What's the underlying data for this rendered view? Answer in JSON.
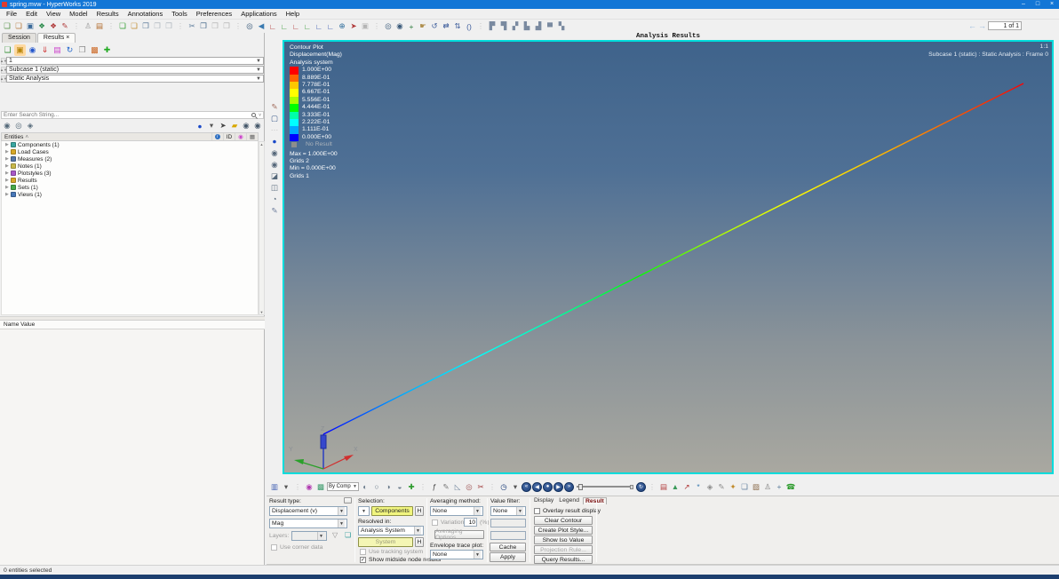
{
  "titlebar": {
    "title": "spring.mvw - HyperWorks 2019",
    "minimize": "–",
    "maximize": "□",
    "close": "×"
  },
  "menu": {
    "items": [
      {
        "n": "menu-file",
        "label": "File"
      },
      {
        "n": "menu-edit",
        "label": "Edit"
      },
      {
        "n": "menu-view",
        "label": "View"
      },
      {
        "n": "menu-model",
        "label": "Model"
      },
      {
        "n": "menu-results",
        "label": "Results"
      },
      {
        "n": "menu-annotations",
        "label": "Annotations"
      },
      {
        "n": "menu-tools",
        "label": "Tools"
      },
      {
        "n": "menu-preferences",
        "label": "Preferences"
      },
      {
        "n": "menu-applications",
        "label": "Applications"
      },
      {
        "n": "menu-help",
        "label": "Help"
      }
    ]
  },
  "toolbar_top": {
    "icons": [
      {
        "n": "open-session-icon",
        "g": "❏",
        "c": "#4a8a3a"
      },
      {
        "n": "save-session-icon",
        "g": "❏",
        "c": "#b07030"
      },
      {
        "n": "save-all-icon",
        "g": "▣",
        "c": "#3a6a9a"
      },
      {
        "n": "organize-icon",
        "g": "❖",
        "c": "#2a8a4a"
      },
      {
        "n": "import-icon",
        "g": "❖",
        "c": "#b03a3a"
      },
      {
        "n": "export-curve-icon",
        "g": "✎",
        "c": "#b03a3a"
      },
      {
        "n": "separator",
        "g": "⋮",
        "c": "#c4c4c4"
      },
      {
        "n": "user-profile-icon",
        "g": "♙",
        "c": "#909090"
      },
      {
        "n": "pages-icon",
        "g": "▤",
        "c": "#b06a2a"
      },
      {
        "n": "separator",
        "g": "⋮",
        "c": "#c4c4c4"
      },
      {
        "n": "add-page-icon",
        "g": "❏",
        "c": "#2a9a2a"
      },
      {
        "n": "delete-page-icon",
        "g": "❏",
        "c": "#c08a2a"
      },
      {
        "n": "new-window-icon",
        "g": "❐",
        "c": "#5a7a9a"
      },
      {
        "n": "expand-window-icon",
        "g": "❐",
        "c": "#aeb6be"
      },
      {
        "n": "swap-pages-icon",
        "g": "❒",
        "c": "#aeb6be"
      },
      {
        "n": "separator",
        "g": "⋮",
        "c": "#c4c4c4"
      },
      {
        "n": "cut-icon",
        "g": "✂",
        "c": "#5a7a9a"
      },
      {
        "n": "copy-icon",
        "g": "❐",
        "c": "#46688a"
      },
      {
        "n": "paste-icon",
        "g": "❒",
        "c": "#b4b4b4"
      },
      {
        "n": "paste-special-icon",
        "g": "❒",
        "c": "#b4b4b4"
      },
      {
        "n": "separator",
        "g": "⋮",
        "c": "#c4c4c4"
      },
      {
        "n": "screen-grab-icon",
        "g": "◎",
        "c": "#3a5a7a"
      },
      {
        "n": "previous-view-icon",
        "g": "◀",
        "c": "#3a7ab0"
      },
      {
        "n": "view-front-icon",
        "g": "∟",
        "c": "#b03a3a"
      },
      {
        "n": "view-back-icon",
        "g": "∟",
        "c": "#3a9a3a"
      },
      {
        "n": "view-left-icon",
        "g": "∟",
        "c": "#b03a3a"
      },
      {
        "n": "view-right-icon",
        "g": "∟",
        "c": "#3a9a3a"
      },
      {
        "n": "view-top-icon",
        "g": "∟",
        "c": "#3a5ab0"
      },
      {
        "n": "view-bottom-icon",
        "g": "∟",
        "c": "#3a5ab0"
      },
      {
        "n": "view-iso-icon",
        "g": "⊕",
        "c": "#2a6a9a"
      },
      {
        "n": "pointer-mode-icon",
        "g": "➤",
        "c": "#b03a3a"
      },
      {
        "n": "snapshot-icon",
        "g": "▣",
        "c": "#b4b4b4"
      },
      {
        "n": "separator",
        "g": "⋮",
        "c": "#c4c4c4"
      },
      {
        "n": "zoom-window-icon",
        "g": "◎",
        "c": "#3a5a7a"
      },
      {
        "n": "zoom-dynamic-icon",
        "g": "◉",
        "c": "#3a5a7a"
      },
      {
        "n": "fit-view-icon",
        "g": "+",
        "c": "#2a7a3a"
      },
      {
        "n": "pan-icon",
        "g": "☛",
        "c": "#b09050"
      },
      {
        "n": "rotate-icon",
        "g": "↺",
        "c": "#3a5a9a"
      },
      {
        "n": "arrows-horizontal-icon",
        "g": "⇄",
        "c": "#3a5a9a"
      },
      {
        "n": "arrows-vertical-icon",
        "g": "⇅",
        "c": "#3a5a9a"
      },
      {
        "n": "center-view-icon",
        "g": "()",
        "c": "#3a5a9a"
      },
      {
        "n": "separator",
        "g": "⋮",
        "c": "#c4c4c4"
      },
      {
        "n": "tile-horizontal-icon",
        "g": "▛",
        "c": "#7a8aa0"
      },
      {
        "n": "tile-vertical-icon",
        "g": "▜",
        "c": "#7a8aa0"
      },
      {
        "n": "tile-grid-icon",
        "g": "▞",
        "c": "#7a8aa0"
      },
      {
        "n": "tile-wide-icon",
        "g": "▙",
        "c": "#7a8aa0"
      },
      {
        "n": "tile-tall-icon",
        "g": "▟",
        "c": "#7a8aa0"
      },
      {
        "n": "tile-single-icon",
        "g": "▀",
        "c": "#7a8aa0"
      },
      {
        "n": "tile-custom-icon",
        "g": "▚",
        "c": "#7a8aa0"
      }
    ],
    "page_nav": {
      "prev": "←",
      "next": "→",
      "value": "1 of 1"
    }
  },
  "browser": {
    "tabs": {
      "session": "Session",
      "results": "Results",
      "close": "×"
    },
    "toolbar": [
      {
        "n": "session-new-icon",
        "g": "❏",
        "c": "#2a8a2a"
      },
      {
        "n": "open-model-icon",
        "g": "▣",
        "c": "#b8860b",
        "bg": "#ffd9a0"
      },
      {
        "n": "load-model-icon",
        "g": "◉",
        "c": "#2255cc"
      },
      {
        "n": "load-results-icon",
        "g": "⇓",
        "c": "#cc2222"
      },
      {
        "n": "contour-file-icon",
        "g": "▤",
        "c": "#cc44cc"
      },
      {
        "n": "refresh-results-icon",
        "g": "↻",
        "c": "#2266cc"
      },
      {
        "n": "copy-file-icon",
        "g": "❐",
        "c": "#8a8a8a"
      },
      {
        "n": "overlay-results-icon",
        "g": "▩",
        "c": "#cc6622"
      },
      {
        "n": "append-results-icon",
        "g": "✚",
        "c": "#22aa22"
      }
    ],
    "combos": {
      "page": "1",
      "subcase": "Subcase 1 (static)",
      "analysis": "Static Analysis"
    },
    "search": {
      "placeholder": "Enter Search String..."
    },
    "vis_icons": [
      {
        "n": "show-entities-icon",
        "g": "◉",
        "c": "#566a7a"
      },
      {
        "n": "hide-entities-icon",
        "g": "◎",
        "c": "#566a7a"
      },
      {
        "n": "isolate-entities-icon",
        "g": "◈",
        "c": "#566a7a"
      }
    ],
    "view_icons": [
      {
        "n": "display-lens-icon",
        "g": "●",
        "c": "#1a49c8"
      },
      {
        "n": "lens-dropdown-icon",
        "g": "▾",
        "c": "#555555"
      },
      {
        "n": "selector-arrow-icon",
        "g": "➤",
        "c": "#444444"
      },
      {
        "n": "highlight-icon",
        "g": "▰",
        "c": "#d8a800"
      },
      {
        "n": "show-hide-eye-icon",
        "g": "◉",
        "c": "#46586a"
      },
      {
        "n": "show-one-eye-icon",
        "g": "◉",
        "c": "#46586a"
      }
    ],
    "entities": {
      "title": "Entities",
      "sort": "˄",
      "col_id": "ID"
    },
    "tree": [
      {
        "n": "tree-item-components",
        "label": "Components (1)",
        "c": "#3aa6a0"
      },
      {
        "n": "tree-item-load-cases",
        "label": "Load Cases",
        "c": "#d8a828"
      },
      {
        "n": "tree-item-measures",
        "label": "Measures (2)",
        "c": "#5577aa"
      },
      {
        "n": "tree-item-notes",
        "label": "Notes (1)",
        "c": "#c8b84a"
      },
      {
        "n": "tree-item-plotstyles",
        "label": "Plotstyles (3)",
        "c": "#a858c8"
      },
      {
        "n": "tree-item-results",
        "label": "Results",
        "c": "#d8a828"
      },
      {
        "n": "tree-item-sets",
        "label": "Sets (1)",
        "c": "#48a848"
      },
      {
        "n": "tree-item-views",
        "label": "Views (1)",
        "c": "#4878b8"
      }
    ],
    "name_value": "Name Value"
  },
  "viewport": {
    "title": "Analysis Results",
    "scale_label": "1:1",
    "frame_label": "Subcase 1 (static) : Static Analysis : Frame 0",
    "axis": {
      "x": "X",
      "y": "Y",
      "z": "Z"
    },
    "legend": {
      "lines": [
        "Contour Plot",
        "Displacement(Mag)",
        "Analysis system"
      ],
      "bands": [
        {
          "n": "legend-band-1",
          "value": "1.000E+00",
          "c": "#ff0000"
        },
        {
          "n": "legend-band-2",
          "value": "8.889E-01",
          "c": "#ff6400"
        },
        {
          "n": "legend-band-3",
          "value": "7.778E-01",
          "c": "#ffc800"
        },
        {
          "n": "legend-band-4",
          "value": "6.667E-01",
          "c": "#ffff00"
        },
        {
          "n": "legend-band-5",
          "value": "5.556E-01",
          "c": "#a8ff00"
        },
        {
          "n": "legend-band-6",
          "value": "4.444E-01",
          "c": "#00ff00"
        },
        {
          "n": "legend-band-7",
          "value": "3.333E-01",
          "c": "#00ffa8"
        },
        {
          "n": "legend-band-8",
          "value": "2.222E-01",
          "c": "#00ffff"
        },
        {
          "n": "legend-band-9",
          "value": "1.111E-01",
          "c": "#00a8ff"
        },
        {
          "n": "legend-band-10",
          "value": "0.000E+00",
          "c": "#0000ff"
        }
      ],
      "no_result": "No Result",
      "stats": [
        "Max = 1.000E+00",
        "Grids 2",
        "Min = 0.000E+00",
        "Grids 1"
      ]
    },
    "side_toolbar": [
      {
        "n": "page-edit-icon",
        "g": "✎",
        "c": "#a06a5a"
      },
      {
        "n": "screen-layout-icon",
        "g": "▢",
        "c": "#3a5a8a"
      },
      {
        "n": "separator",
        "g": "⋯",
        "c": "#c4c4c4"
      },
      {
        "n": "view-lens-icon",
        "g": "●",
        "c": "#1a49c8"
      },
      {
        "n": "eye-restore-icon",
        "g": "◉",
        "c": "#56687a"
      },
      {
        "n": "eye-previous-icon",
        "g": "◉",
        "c": "#56687a"
      },
      {
        "n": "eye-capture-icon",
        "g": "◪",
        "c": "#56687a"
      },
      {
        "n": "eye-save-icon",
        "g": "◫",
        "c": "#56687a"
      },
      {
        "n": "eye-mask-icon",
        "g": "◔",
        "c": "#56687a"
      },
      {
        "n": "brush-icon",
        "g": "✎",
        "c": "#6a7a9a"
      }
    ]
  },
  "toolbar_result": {
    "icons_left": [
      {
        "n": "contour-mode-icon",
        "g": "▥",
        "c": "#3a5ab0"
      },
      {
        "n": "contour-dropdown-icon",
        "g": "▾",
        "c": "#555555"
      },
      {
        "n": "separator",
        "g": "⋮",
        "c": "#c4c4c4"
      },
      {
        "n": "legend-colors-icon",
        "g": "◉",
        "c": "#b03ab0"
      },
      {
        "n": "result-display-icon",
        "g": "▩",
        "c": "#3a9a6a"
      }
    ],
    "by_comp": "By Comp",
    "icons_mid": [
      {
        "n": "shaded-mesh-icon",
        "g": "◐",
        "c": "#6a7a8a"
      },
      {
        "n": "wireframe-mesh-icon",
        "g": "○",
        "c": "#6a7a8a"
      },
      {
        "n": "element-color-icon",
        "g": "◑",
        "c": "#6a7a8a"
      },
      {
        "n": "feature-lines-icon",
        "g": "◒",
        "c": "#6a7a8a"
      },
      {
        "n": "mask-add-icon",
        "g": "✚",
        "c": "#2a9a2a"
      },
      {
        "n": "separator",
        "g": "⋮",
        "c": "#c4c4c4"
      },
      {
        "n": "quick-query-icon",
        "g": "ƒ",
        "c": "#444444"
      },
      {
        "n": "note-create-icon",
        "g": "✎",
        "c": "#777777"
      },
      {
        "n": "measure-create-icon",
        "g": "◺",
        "c": "#778aa0"
      },
      {
        "n": "tracking-system-icon",
        "g": "◎",
        "c": "#a05a5a"
      },
      {
        "n": "section-cut-icon",
        "g": "✂",
        "c": "#a03a3a"
      },
      {
        "n": "separator",
        "g": "⋮",
        "c": "#c4c4c4"
      },
      {
        "n": "animation-clock-icon",
        "g": "◷",
        "c": "#1c3e78"
      },
      {
        "n": "clock-dropdown-icon",
        "g": "▾",
        "c": "#555555"
      }
    ],
    "anim_buttons": [
      {
        "n": "first-frame-button",
        "g": "«"
      },
      {
        "n": "previous-frame-button",
        "g": "◀"
      },
      {
        "n": "stop-button",
        "g": "●"
      },
      {
        "n": "play-button",
        "g": "▶"
      },
      {
        "n": "last-frame-button",
        "g": "»"
      }
    ],
    "loop_button": "↻",
    "icons_right": [
      {
        "n": "separator",
        "g": "⋮",
        "c": "#c4c4c4"
      },
      {
        "n": "contour-toggle-icon",
        "g": "▤",
        "c": "#b03a3a"
      },
      {
        "n": "iso-toggle-icon",
        "g": "▲",
        "c": "#3a9a5a"
      },
      {
        "n": "vector-toggle-icon",
        "g": "↗",
        "c": "#b03a3a"
      },
      {
        "n": "tensor-toggle-icon",
        "g": "*",
        "c": "#3a7ab0"
      },
      {
        "n": "deformed-toggle-icon",
        "g": "◈",
        "c": "#8a8a8a"
      },
      {
        "n": "contour-edit-icon",
        "g": "✎",
        "c": "#8a8a8a"
      },
      {
        "n": "exploded-view-icon",
        "g": "✦",
        "c": "#c08a2a"
      },
      {
        "n": "object-window-icon",
        "g": "❏",
        "c": "#5a7a9a"
      },
      {
        "n": "build-plots-icon",
        "g": "▨",
        "c": "#8a6a4a"
      },
      {
        "n": "session-browser-icon",
        "g": "♙",
        "c": "#777777"
      },
      {
        "n": "systems-icon",
        "g": "+",
        "c": "#5a7a9a"
      },
      {
        "n": "support-phone-icon",
        "g": "☎",
        "c": "#2a9a2a"
      }
    ]
  },
  "panel": {
    "result_type": {
      "label": "Result type:",
      "combo1": "Displacement (v)",
      "combo2": "Mag",
      "layers": "Layers:",
      "use_corner": "Use corner data"
    },
    "selection": {
      "label": "Selection:",
      "components": "Components",
      "h": "H",
      "resolved_in": "Resolved in:",
      "analysis_system": "Analysis System",
      "system": "System",
      "tracking": "Use tracking system",
      "midside": "Show midside node results",
      "midside_check": "✓"
    },
    "averaging": {
      "label": "Averaging method:",
      "value": "None",
      "variation": "Variation <",
      "variation_value": "10",
      "pct": "(%)",
      "options": "Averaging Options...",
      "envelope": "Envelope trace plot:",
      "envelope_value": "None"
    },
    "value_filter": {
      "label": "Value filter:",
      "value": "None",
      "cache": "Cache",
      "apply": "Apply"
    },
    "result_tabs": {
      "display": "Display",
      "legend": "Legend",
      "result": "Result",
      "overlay": "Overlay result display",
      "buttons": [
        {
          "n": "clear-contour-button",
          "label": "Clear Contour",
          "dis": ""
        },
        {
          "n": "create-plot-style-button",
          "label": "Create Plot Style...",
          "dis": ""
        },
        {
          "n": "show-iso-value-button",
          "label": "Show Iso Value",
          "dis": ""
        },
        {
          "n": "projection-rule-button",
          "label": "Projection Rule...",
          "dis": "1"
        },
        {
          "n": "query-results-button",
          "label": "Query Results...",
          "dis": ""
        }
      ]
    }
  },
  "statusbar": {
    "text": "0 entities selected"
  }
}
